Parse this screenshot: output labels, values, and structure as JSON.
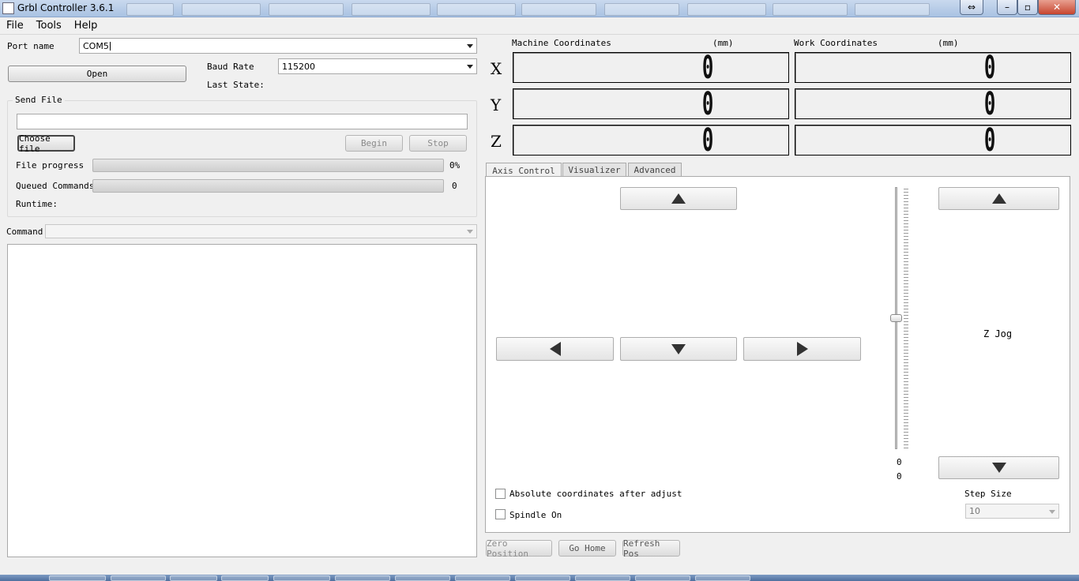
{
  "window": {
    "title": "Grbl Controller 3.6.1"
  },
  "menu": [
    "File",
    "Tools",
    "Help"
  ],
  "connection": {
    "port_label": "Port name",
    "port_value": "COM5",
    "open_label": "Open",
    "baud_label": "Baud Rate",
    "baud_value": "115200",
    "last_state_label": "Last State:"
  },
  "send_file": {
    "title": "Send File",
    "choose_label": "Choose file",
    "begin_label": "Begin",
    "stop_label": "Stop",
    "file_progress_label": "File progress",
    "file_progress_value": "0%",
    "file_progress_fraction": 0,
    "queued_label": "Queued Commands",
    "queued_value": "0",
    "queued_fraction": 0,
    "runtime_label": "Runtime:"
  },
  "command": {
    "label": "Command"
  },
  "coords": {
    "machine_label": "Machine Coordinates",
    "work_label": "Work Coordinates",
    "unit": "(mm)",
    "rows": [
      {
        "axis": "X",
        "machine": "0",
        "work": "0"
      },
      {
        "axis": "Y",
        "machine": "0",
        "work": "0"
      },
      {
        "axis": "Z",
        "machine": "0",
        "work": "0"
      }
    ]
  },
  "tabs": [
    "Axis Control",
    "Visualizer",
    "Advanced"
  ],
  "axis_control": {
    "z_jog_label": "Z Jog",
    "slider_value_1": "0",
    "slider_value_2": "0",
    "absolute_label": "Absolute coordinates after adjust",
    "spindle_label": "Spindle On",
    "step_size_label": "Step Size",
    "step_size_value": "10"
  },
  "bottom_buttons": {
    "zero": "Zero Position",
    "home": "Go Home",
    "refresh": "Refresh Pos"
  },
  "icons": [
    "app-icon",
    "restore-icon",
    "minimize-icon",
    "maximize-icon",
    "close-icon",
    "arrow-up-icon",
    "arrow-down-icon",
    "arrow-left-icon",
    "arrow-right-icon",
    "chevron-down-icon"
  ]
}
